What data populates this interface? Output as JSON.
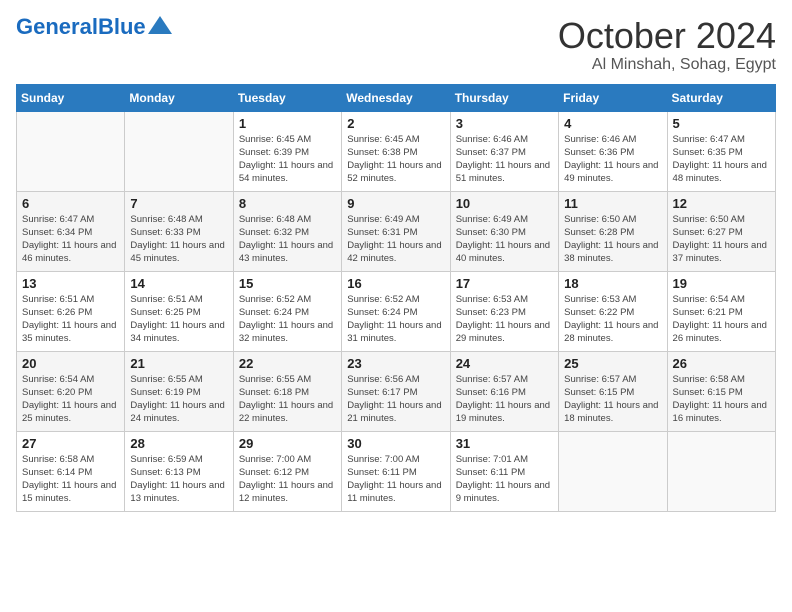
{
  "header": {
    "logo_general": "General",
    "logo_blue": "Blue",
    "month_title": "October 2024",
    "location": "Al Minshah, Sohag, Egypt"
  },
  "weekdays": [
    "Sunday",
    "Monday",
    "Tuesday",
    "Wednesday",
    "Thursday",
    "Friday",
    "Saturday"
  ],
  "weeks": [
    [
      {
        "day": "",
        "sunrise": "",
        "sunset": "",
        "daylight": ""
      },
      {
        "day": "",
        "sunrise": "",
        "sunset": "",
        "daylight": ""
      },
      {
        "day": "1",
        "sunrise": "Sunrise: 6:45 AM",
        "sunset": "Sunset: 6:39 PM",
        "daylight": "Daylight: 11 hours and 54 minutes."
      },
      {
        "day": "2",
        "sunrise": "Sunrise: 6:45 AM",
        "sunset": "Sunset: 6:38 PM",
        "daylight": "Daylight: 11 hours and 52 minutes."
      },
      {
        "day": "3",
        "sunrise": "Sunrise: 6:46 AM",
        "sunset": "Sunset: 6:37 PM",
        "daylight": "Daylight: 11 hours and 51 minutes."
      },
      {
        "day": "4",
        "sunrise": "Sunrise: 6:46 AM",
        "sunset": "Sunset: 6:36 PM",
        "daylight": "Daylight: 11 hours and 49 minutes."
      },
      {
        "day": "5",
        "sunrise": "Sunrise: 6:47 AM",
        "sunset": "Sunset: 6:35 PM",
        "daylight": "Daylight: 11 hours and 48 minutes."
      }
    ],
    [
      {
        "day": "6",
        "sunrise": "Sunrise: 6:47 AM",
        "sunset": "Sunset: 6:34 PM",
        "daylight": "Daylight: 11 hours and 46 minutes."
      },
      {
        "day": "7",
        "sunrise": "Sunrise: 6:48 AM",
        "sunset": "Sunset: 6:33 PM",
        "daylight": "Daylight: 11 hours and 45 minutes."
      },
      {
        "day": "8",
        "sunrise": "Sunrise: 6:48 AM",
        "sunset": "Sunset: 6:32 PM",
        "daylight": "Daylight: 11 hours and 43 minutes."
      },
      {
        "day": "9",
        "sunrise": "Sunrise: 6:49 AM",
        "sunset": "Sunset: 6:31 PM",
        "daylight": "Daylight: 11 hours and 42 minutes."
      },
      {
        "day": "10",
        "sunrise": "Sunrise: 6:49 AM",
        "sunset": "Sunset: 6:30 PM",
        "daylight": "Daylight: 11 hours and 40 minutes."
      },
      {
        "day": "11",
        "sunrise": "Sunrise: 6:50 AM",
        "sunset": "Sunset: 6:28 PM",
        "daylight": "Daylight: 11 hours and 38 minutes."
      },
      {
        "day": "12",
        "sunrise": "Sunrise: 6:50 AM",
        "sunset": "Sunset: 6:27 PM",
        "daylight": "Daylight: 11 hours and 37 minutes."
      }
    ],
    [
      {
        "day": "13",
        "sunrise": "Sunrise: 6:51 AM",
        "sunset": "Sunset: 6:26 PM",
        "daylight": "Daylight: 11 hours and 35 minutes."
      },
      {
        "day": "14",
        "sunrise": "Sunrise: 6:51 AM",
        "sunset": "Sunset: 6:25 PM",
        "daylight": "Daylight: 11 hours and 34 minutes."
      },
      {
        "day": "15",
        "sunrise": "Sunrise: 6:52 AM",
        "sunset": "Sunset: 6:24 PM",
        "daylight": "Daylight: 11 hours and 32 minutes."
      },
      {
        "day": "16",
        "sunrise": "Sunrise: 6:52 AM",
        "sunset": "Sunset: 6:24 PM",
        "daylight": "Daylight: 11 hours and 31 minutes."
      },
      {
        "day": "17",
        "sunrise": "Sunrise: 6:53 AM",
        "sunset": "Sunset: 6:23 PM",
        "daylight": "Daylight: 11 hours and 29 minutes."
      },
      {
        "day": "18",
        "sunrise": "Sunrise: 6:53 AM",
        "sunset": "Sunset: 6:22 PM",
        "daylight": "Daylight: 11 hours and 28 minutes."
      },
      {
        "day": "19",
        "sunrise": "Sunrise: 6:54 AM",
        "sunset": "Sunset: 6:21 PM",
        "daylight": "Daylight: 11 hours and 26 minutes."
      }
    ],
    [
      {
        "day": "20",
        "sunrise": "Sunrise: 6:54 AM",
        "sunset": "Sunset: 6:20 PM",
        "daylight": "Daylight: 11 hours and 25 minutes."
      },
      {
        "day": "21",
        "sunrise": "Sunrise: 6:55 AM",
        "sunset": "Sunset: 6:19 PM",
        "daylight": "Daylight: 11 hours and 24 minutes."
      },
      {
        "day": "22",
        "sunrise": "Sunrise: 6:55 AM",
        "sunset": "Sunset: 6:18 PM",
        "daylight": "Daylight: 11 hours and 22 minutes."
      },
      {
        "day": "23",
        "sunrise": "Sunrise: 6:56 AM",
        "sunset": "Sunset: 6:17 PM",
        "daylight": "Daylight: 11 hours and 21 minutes."
      },
      {
        "day": "24",
        "sunrise": "Sunrise: 6:57 AM",
        "sunset": "Sunset: 6:16 PM",
        "daylight": "Daylight: 11 hours and 19 minutes."
      },
      {
        "day": "25",
        "sunrise": "Sunrise: 6:57 AM",
        "sunset": "Sunset: 6:15 PM",
        "daylight": "Daylight: 11 hours and 18 minutes."
      },
      {
        "day": "26",
        "sunrise": "Sunrise: 6:58 AM",
        "sunset": "Sunset: 6:15 PM",
        "daylight": "Daylight: 11 hours and 16 minutes."
      }
    ],
    [
      {
        "day": "27",
        "sunrise": "Sunrise: 6:58 AM",
        "sunset": "Sunset: 6:14 PM",
        "daylight": "Daylight: 11 hours and 15 minutes."
      },
      {
        "day": "28",
        "sunrise": "Sunrise: 6:59 AM",
        "sunset": "Sunset: 6:13 PM",
        "daylight": "Daylight: 11 hours and 13 minutes."
      },
      {
        "day": "29",
        "sunrise": "Sunrise: 7:00 AM",
        "sunset": "Sunset: 6:12 PM",
        "daylight": "Daylight: 11 hours and 12 minutes."
      },
      {
        "day": "30",
        "sunrise": "Sunrise: 7:00 AM",
        "sunset": "Sunset: 6:11 PM",
        "daylight": "Daylight: 11 hours and 11 minutes."
      },
      {
        "day": "31",
        "sunrise": "Sunrise: 7:01 AM",
        "sunset": "Sunset: 6:11 PM",
        "daylight": "Daylight: 11 hours and 9 minutes."
      },
      {
        "day": "",
        "sunrise": "",
        "sunset": "",
        "daylight": ""
      },
      {
        "day": "",
        "sunrise": "",
        "sunset": "",
        "daylight": ""
      }
    ]
  ]
}
